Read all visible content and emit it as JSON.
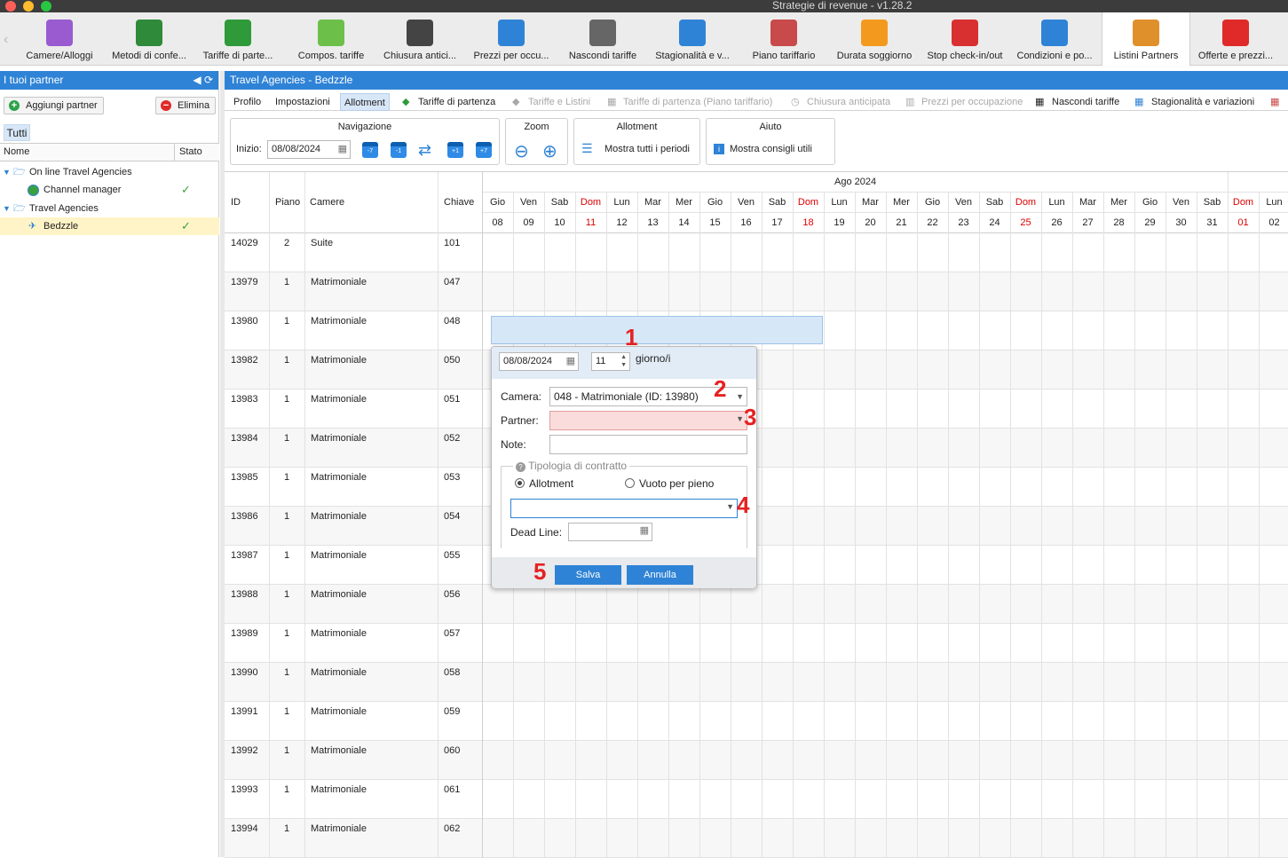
{
  "window": {
    "title": "Strategie di revenue - v1.28.2"
  },
  "toolbar": {
    "items": [
      {
        "label": "Camere/Alloggi",
        "icon": "bed-icon",
        "color": "#9a5bd0"
      },
      {
        "label": "Metodi di confe...",
        "icon": "money-icon",
        "color": "#2f8a3a"
      },
      {
        "label": "Tariffe di parte...",
        "icon": "tag-icon",
        "color": "#2f9a3a"
      },
      {
        "label": "Compos. tariffe",
        "icon": "puzzle-icon",
        "color": "#6cc04a"
      },
      {
        "label": "Chiusura antici...",
        "icon": "stopwatch-icon",
        "color": "#444444"
      },
      {
        "label": "Prezzi per occu...",
        "icon": "bar-chart-icon",
        "color": "#2f83d6"
      },
      {
        "label": "Nascondi tariffe",
        "icon": "hide-calendar-icon",
        "color": "#666666"
      },
      {
        "label": "Stagionalità e v...",
        "icon": "season-calendar-icon",
        "color": "#2f83d6"
      },
      {
        "label": "Piano tariffario",
        "icon": "grid-calendar-icon",
        "color": "#c84a4a"
      },
      {
        "label": "Durata soggiorno",
        "icon": "duration-calendar-icon",
        "color": "#f39a1e"
      },
      {
        "label": "Stop check-in/out",
        "icon": "stop-calendar-icon",
        "color": "#d83030"
      },
      {
        "label": "Condizioni e po...",
        "icon": "document-icon",
        "color": "#2f83d6"
      },
      {
        "label": "Listini Partners",
        "icon": "handshake-icon",
        "color": "#e0902a",
        "active": true
      },
      {
        "label": "Offerte e prezzi...",
        "icon": "discount-icon",
        "color": "#e02a2a"
      }
    ]
  },
  "left": {
    "header": "I tuoi partner",
    "add_label": "Aggiungi partner",
    "delete_label": "Elimina",
    "filter_tab": "Tutti",
    "col_name": "Nome",
    "col_status": "Stato",
    "tree": [
      {
        "label": "On line Travel Agencies"
      },
      {
        "label": "Channel manager"
      },
      {
        "label": "Travel Agencies"
      },
      {
        "label": "Bedzzle"
      }
    ]
  },
  "main": {
    "header": "Travel Agencies - Bedzzle",
    "tabs": [
      "Profilo",
      "Impostazioni",
      "Allotment",
      "Tariffe di partenza",
      "Tariffe e Listini",
      "Tariffe di partenza (Piano tariffario)",
      "Chiusura anticipata",
      "Prezzi per occupazione",
      "Nascondi tariffe",
      "Stagionalità e variazioni"
    ],
    "nav": {
      "title": "Navigazione",
      "start_label": "Inizio:",
      "start_value": "08/08/2024",
      "btn_m7": "-7",
      "btn_m1": "-1",
      "btn_p1": "+1",
      "btn_p7": "+7"
    },
    "zoom": {
      "title": "Zoom"
    },
    "allotment": {
      "title": "Allotment",
      "show_all": "Mostra tutti i periodi"
    },
    "help": {
      "title": "Aiuto",
      "tips": "Mostra consigli utili"
    }
  },
  "grid": {
    "headers": {
      "id": "ID",
      "floor": "Piano",
      "rooms": "Camere",
      "key": "Chiave"
    },
    "month": "Ago 2024",
    "days": [
      {
        "n": "Gio",
        "d": "08"
      },
      {
        "n": "Ven",
        "d": "09"
      },
      {
        "n": "Sab",
        "d": "10"
      },
      {
        "n": "Dom",
        "d": "11"
      },
      {
        "n": "Lun",
        "d": "12"
      },
      {
        "n": "Mar",
        "d": "13"
      },
      {
        "n": "Mer",
        "d": "14"
      },
      {
        "n": "Gio",
        "d": "15"
      },
      {
        "n": "Ven",
        "d": "16"
      },
      {
        "n": "Sab",
        "d": "17"
      },
      {
        "n": "Dom",
        "d": "18"
      },
      {
        "n": "Lun",
        "d": "19"
      },
      {
        "n": "Mar",
        "d": "20"
      },
      {
        "n": "Mer",
        "d": "21"
      },
      {
        "n": "Gio",
        "d": "22"
      },
      {
        "n": "Ven",
        "d": "23"
      },
      {
        "n": "Sab",
        "d": "24"
      },
      {
        "n": "Dom",
        "d": "25"
      },
      {
        "n": "Lun",
        "d": "26"
      },
      {
        "n": "Mar",
        "d": "27"
      },
      {
        "n": "Mer",
        "d": "28"
      },
      {
        "n": "Gio",
        "d": "29"
      },
      {
        "n": "Ven",
        "d": "30"
      },
      {
        "n": "Sab",
        "d": "31"
      },
      {
        "n": "Dom",
        "d": "01"
      },
      {
        "n": "Lun",
        "d": "02"
      }
    ],
    "rows": [
      {
        "id": "14029",
        "floor": "2",
        "room": "Suite",
        "key": "101"
      },
      {
        "id": "13979",
        "floor": "1",
        "room": "Matrimoniale",
        "key": "047"
      },
      {
        "id": "13980",
        "floor": "1",
        "room": "Matrimoniale",
        "key": "048"
      },
      {
        "id": "13982",
        "floor": "1",
        "room": "Matrimoniale",
        "key": "050"
      },
      {
        "id": "13983",
        "floor": "1",
        "room": "Matrimoniale",
        "key": "051"
      },
      {
        "id": "13984",
        "floor": "1",
        "room": "Matrimoniale",
        "key": "052"
      },
      {
        "id": "13985",
        "floor": "1",
        "room": "Matrimoniale",
        "key": "053"
      },
      {
        "id": "13986",
        "floor": "1",
        "room": "Matrimoniale",
        "key": "054"
      },
      {
        "id": "13987",
        "floor": "1",
        "room": "Matrimoniale",
        "key": "055"
      },
      {
        "id": "13988",
        "floor": "1",
        "room": "Matrimoniale",
        "key": "056"
      },
      {
        "id": "13989",
        "floor": "1",
        "room": "Matrimoniale",
        "key": "057"
      },
      {
        "id": "13990",
        "floor": "1",
        "room": "Matrimoniale",
        "key": "058"
      },
      {
        "id": "13991",
        "floor": "1",
        "room": "Matrimoniale",
        "key": "059"
      },
      {
        "id": "13992",
        "floor": "1",
        "room": "Matrimoniale",
        "key": "060"
      },
      {
        "id": "13993",
        "floor": "1",
        "room": "Matrimoniale",
        "key": "061"
      },
      {
        "id": "13994",
        "floor": "1",
        "room": "Matrimoniale",
        "key": "062"
      }
    ]
  },
  "popup": {
    "date": "08/08/2024",
    "days": "11",
    "days_unit": "giorno/i",
    "camera_label": "Camera:",
    "camera_value": "048 - Matrimoniale (ID: 13980)",
    "partner_label": "Partner:",
    "partner_value": "",
    "note_label": "Note:",
    "note_value": "",
    "contract_legend": "Tipologia di contratto",
    "radio_allotment": "Allotment",
    "radio_vuoto": "Vuoto per pieno",
    "contract_select_value": "",
    "deadline_label": "Dead Line:",
    "deadline_value": "",
    "save": "Salva",
    "cancel": "Annulla",
    "markers": [
      "1",
      "2",
      "3",
      "4",
      "5"
    ]
  }
}
